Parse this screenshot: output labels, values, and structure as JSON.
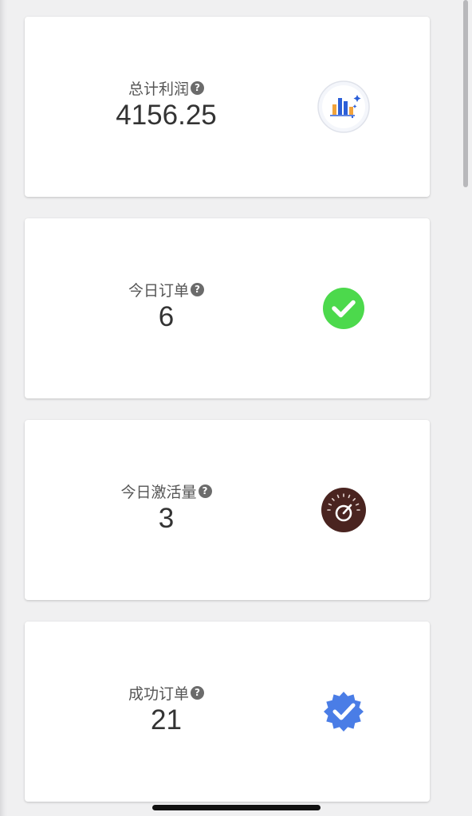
{
  "cards": [
    {
      "label": "总计利润",
      "value": "4156.25",
      "icon": "bar-chart-icon"
    },
    {
      "label": "今日订单",
      "value": "6",
      "icon": "check-circle-icon"
    },
    {
      "label": "今日激活量",
      "value": "3",
      "icon": "speedometer-icon"
    },
    {
      "label": "成功订单",
      "value": "21",
      "icon": "verified-badge-icon"
    }
  ],
  "help_glyph": "?",
  "colors": {
    "page_bg": "#f0f0f1",
    "card_bg": "#ffffff",
    "check_green": "#4cd94c",
    "gauge_brown": "#4a2420",
    "badge_blue": "#4a7de6"
  }
}
